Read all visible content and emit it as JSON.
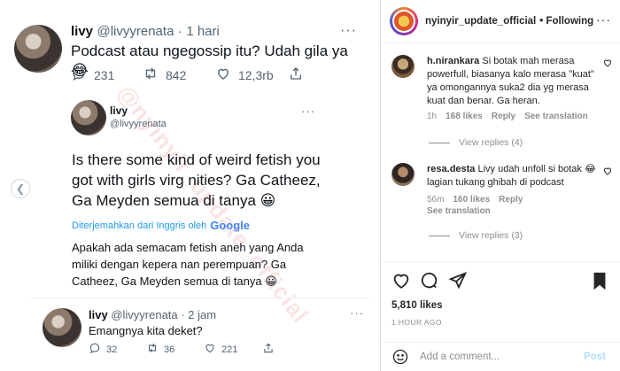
{
  "tweet": {
    "name": "livy",
    "handle": "@livyyrenata",
    "sep": "·",
    "time": "1 hari",
    "text": "Podcast atau ngegossip itu? Udah gila ya 😂",
    "replies": "231",
    "retweets": "842",
    "likes": "12,3rb"
  },
  "quote": {
    "name": "livy",
    "handle": "@livyyrenata",
    "text": "Is there some kind of weird fetish you got with girls virg nities? Ga Catheez, Ga Meyden semua di tanya 😀",
    "translated_by": "Diterjemahkan dari Inggris oleh",
    "translator": "Google",
    "translation": "Apakah ada semacam fetish aneh yang Anda miliki dengan kepera     nan perempuan? Ga Catheez, Ga Meyden semua di tanya 😀"
  },
  "reply": {
    "name": "livy",
    "handle": "@livyyrenata",
    "sep": "·",
    "time": "2 jam",
    "text": "Emangnya kita deket?",
    "replies": "32",
    "retweets": "36",
    "likes": "221"
  },
  "watermark": "@nyinyir_update_official",
  "instagram": {
    "username": "nyinyir_update_official",
    "following": "• Following",
    "comments": [
      {
        "user": "h.nirankara",
        "text": "Si botak mah merasa powerfull, biasanya kalo merasa \"kuat\" ya omongannya suka2 dia yg merasa kuat dan benar. Ga heran.",
        "time": "1h",
        "likes": "168 likes",
        "reply": "Reply",
        "see_translation": "See translation",
        "view_replies": "View replies (4)"
      },
      {
        "user": "resa.desta",
        "text": "Livy udah unfoll si botak 😂 lagian tukang ghibah di podcast",
        "time": "56m",
        "likes": "160 likes",
        "reply": "Reply",
        "see_translation": "See translation",
        "view_replies": "View replies (3)"
      }
    ],
    "likes_count": "5,810 likes",
    "posted": "1 HOUR AGO",
    "add_comment_placeholder": "Add a comment...",
    "post_label": "Post"
  }
}
